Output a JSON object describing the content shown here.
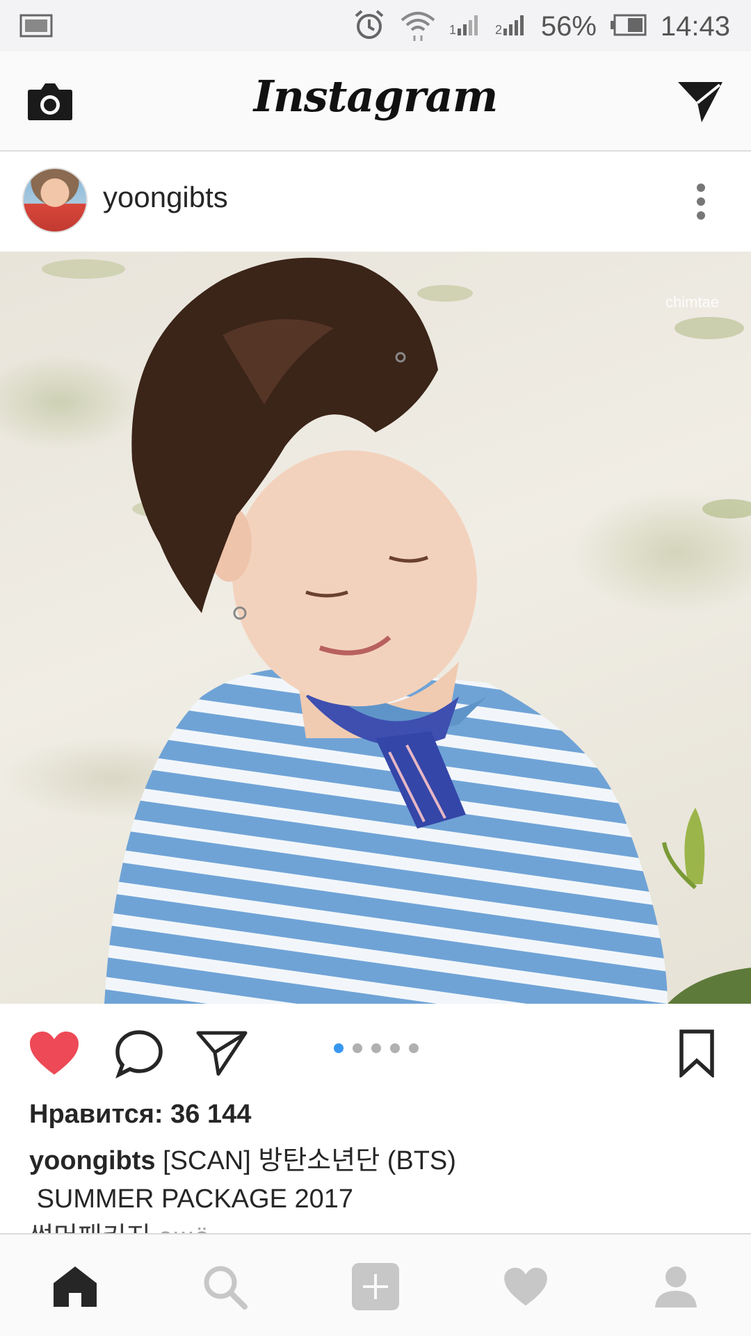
{
  "status_bar": {
    "battery_percent": "56%",
    "time": "14:43",
    "icons": [
      "screenshot-icon",
      "alarm-icon",
      "wifi-icon",
      "signal-1-icon",
      "signal-2-icon",
      "battery-icon"
    ]
  },
  "app_bar": {
    "title": "Instagram",
    "left_icon": "camera-icon",
    "right_icon": "direct-message-icon"
  },
  "post": {
    "username": "yoongibts",
    "watermark": "chimtae",
    "carousel": {
      "count": 5,
      "active_index": 0
    },
    "likes": "Нравится: 36 144",
    "caption": {
      "username": "yoongibts",
      "line1": "[SCAN] 방탄소년단 (BTS)",
      "line2": "SUMMER PACKAGE 2017",
      "line3": "썸머패키지",
      "more": "ещё"
    }
  },
  "colors": {
    "like_red": "#ed4956",
    "carousel_active": "#3897f0",
    "text": "#262626"
  },
  "bottom_nav": [
    "home-icon",
    "search-icon",
    "add-post-icon",
    "activity-heart-icon",
    "profile-icon"
  ]
}
